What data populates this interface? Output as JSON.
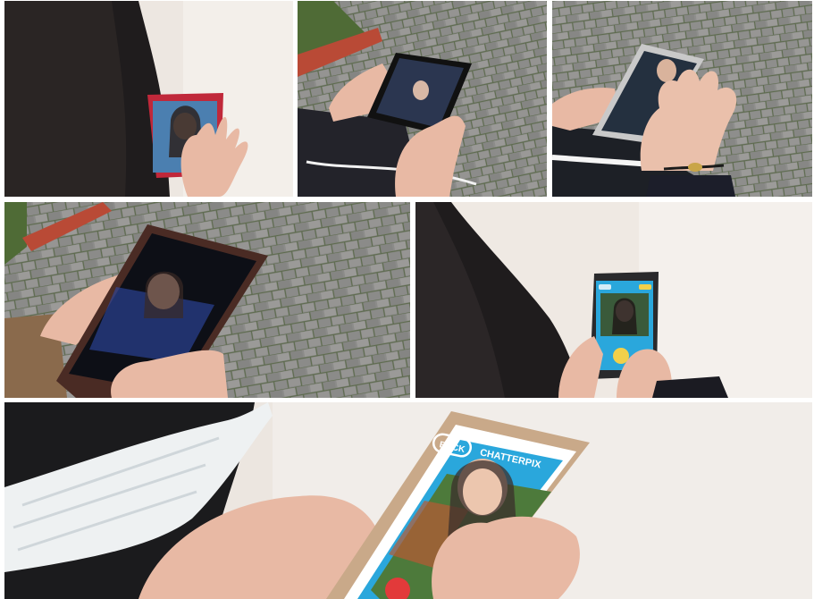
{
  "collage": {
    "photos": [
      {
        "id": "p1",
        "subject": "girl-with-long-dark-hair-using-red-phone-on-table"
      },
      {
        "id": "p2",
        "subject": "hands-holding-black-phone-over-paving-stones"
      },
      {
        "id": "p3",
        "subject": "hands-holding-white-phone-over-paving-stones"
      },
      {
        "id": "p4",
        "subject": "hands-holding-large-phone-showing-avatar"
      },
      {
        "id": "p5",
        "subject": "girl-holding-phone-with-blue-app-screen-on-table"
      },
      {
        "id": "p6",
        "subject": "masked-student-holding-phone-showing-avatar-app"
      }
    ],
    "app_screen": {
      "back_label": "BACK",
      "title": "CHATTERPIX"
    },
    "colors": {
      "paving": "#8a8a88",
      "paving_joint": "#5e6b4f",
      "table": "#efe9e3",
      "app_blue": "#2aa7dc",
      "hair": "#1f1c1d",
      "skin": "#e8b9a4"
    }
  }
}
